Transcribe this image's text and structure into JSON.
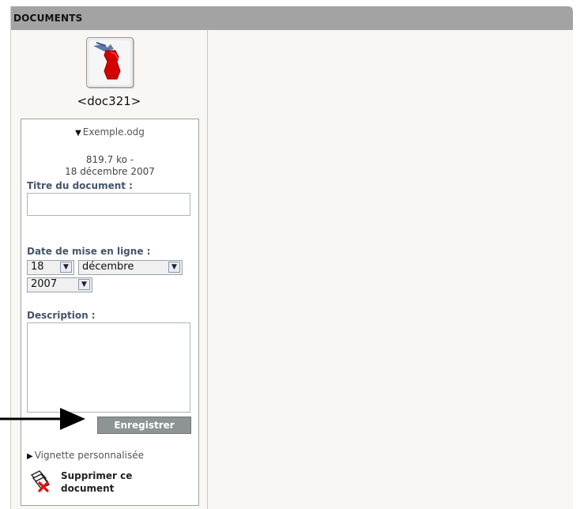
{
  "header": {
    "title": "DOCUMENTS"
  },
  "document": {
    "label": "<doc321>",
    "filename": "Exemple.odg",
    "size": "819.7 ko -",
    "date": "18 décembre 2007"
  },
  "form": {
    "title_label": "Titre du document :",
    "title_value": "",
    "date_label": "Date de mise en ligne :",
    "day": "18",
    "month": "décembre",
    "year": "2007",
    "description_label": "Description :",
    "description_value": "",
    "save_label": "Enregistrer"
  },
  "links": {
    "thumbnail": "Vignette personnalisée",
    "delete_line1": "Supprimer ce",
    "delete_line2": "document"
  },
  "icons": {
    "doc": "document-file-icon",
    "disclosure": "triangle-down-icon",
    "disclosure_right": "triangle-right-icon",
    "delete": "delete-document-icon",
    "pointer": "arrow-right-icon"
  }
}
